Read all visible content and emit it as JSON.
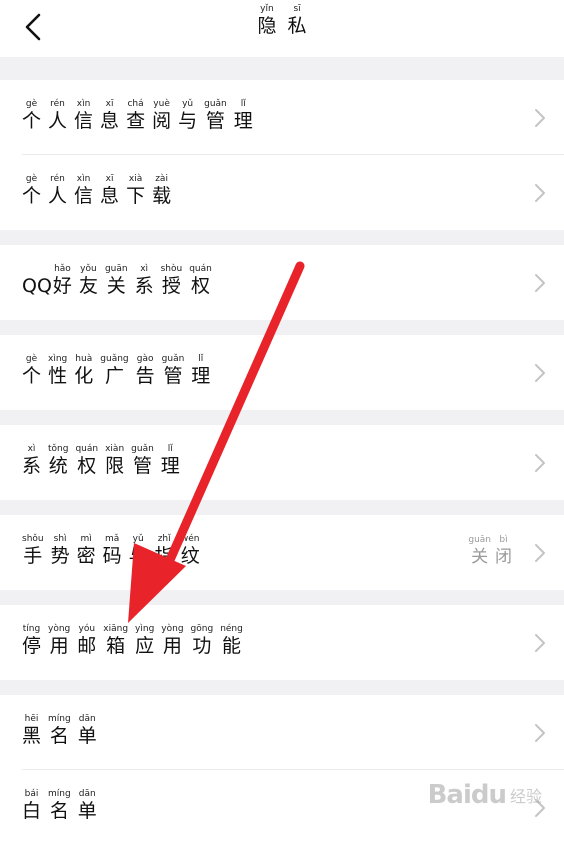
{
  "header": {
    "title": [
      {
        "py": "yǐn",
        "hz": "隐"
      },
      {
        "py": "sī",
        "hz": "私"
      }
    ]
  },
  "groups": [
    {
      "items": [
        {
          "chars": [
            {
              "py": "gè",
              "hz": "个"
            },
            {
              "py": "rén",
              "hz": "人"
            },
            {
              "py": "xìn",
              "hz": "信"
            },
            {
              "py": "xī",
              "hz": "息"
            },
            {
              "py": "chá",
              "hz": "查"
            },
            {
              "py": "yuè",
              "hz": "阅"
            },
            {
              "py": "yǔ",
              "hz": "与"
            },
            {
              "py": "guǎn",
              "hz": "管"
            },
            {
              "py": "lǐ",
              "hz": "理"
            }
          ]
        },
        {
          "chars": [
            {
              "py": "gè",
              "hz": "个"
            },
            {
              "py": "rén",
              "hz": "人"
            },
            {
              "py": "xìn",
              "hz": "信"
            },
            {
              "py": "xī",
              "hz": "息"
            },
            {
              "py": "xià",
              "hz": "下"
            },
            {
              "py": "zài",
              "hz": "载"
            }
          ]
        }
      ]
    },
    {
      "items": [
        {
          "prefix": "QQ",
          "chars": [
            {
              "py": "hǎo",
              "hz": "好"
            },
            {
              "py": "yǒu",
              "hz": "友"
            },
            {
              "py": "guān",
              "hz": "关"
            },
            {
              "py": "xì",
              "hz": "系"
            },
            {
              "py": "shòu",
              "hz": "授"
            },
            {
              "py": "quán",
              "hz": "权"
            }
          ]
        }
      ]
    },
    {
      "items": [
        {
          "chars": [
            {
              "py": "gè",
              "hz": "个"
            },
            {
              "py": "xìng",
              "hz": "性"
            },
            {
              "py": "huà",
              "hz": "化"
            },
            {
              "py": "guǎng",
              "hz": "广"
            },
            {
              "py": "gào",
              "hz": "告"
            },
            {
              "py": "guǎn",
              "hz": "管"
            },
            {
              "py": "lǐ",
              "hz": "理"
            }
          ]
        }
      ]
    },
    {
      "items": [
        {
          "chars": [
            {
              "py": "xì",
              "hz": "系"
            },
            {
              "py": "tǒng",
              "hz": "统"
            },
            {
              "py": "quán",
              "hz": "权"
            },
            {
              "py": "xiàn",
              "hz": "限"
            },
            {
              "py": "guǎn",
              "hz": "管"
            },
            {
              "py": "lǐ",
              "hz": "理"
            }
          ]
        }
      ]
    },
    {
      "items": [
        {
          "chars": [
            {
              "py": "shǒu",
              "hz": "手"
            },
            {
              "py": "shì",
              "hz": "势"
            },
            {
              "py": "mì",
              "hz": "密"
            },
            {
              "py": "mǎ",
              "hz": "码"
            },
            {
              "py": "yǔ",
              "hz": "与"
            },
            {
              "py": "zhǐ",
              "hz": "指"
            },
            {
              "py": "wén",
              "hz": "纹"
            }
          ],
          "status": [
            {
              "py": "guān",
              "hz": "关"
            },
            {
              "py": "bì",
              "hz": "闭"
            }
          ]
        }
      ]
    },
    {
      "items": [
        {
          "chars": [
            {
              "py": "tíng",
              "hz": "停"
            },
            {
              "py": "yòng",
              "hz": "用"
            },
            {
              "py": "yóu",
              "hz": "邮"
            },
            {
              "py": "xiāng",
              "hz": "箱"
            },
            {
              "py": "yìng",
              "hz": "应"
            },
            {
              "py": "yòng",
              "hz": "用"
            },
            {
              "py": "gōng",
              "hz": "功"
            },
            {
              "py": "néng",
              "hz": "能"
            }
          ]
        }
      ]
    },
    {
      "items": [
        {
          "chars": [
            {
              "py": "hēi",
              "hz": "黑"
            },
            {
              "py": "míng",
              "hz": "名"
            },
            {
              "py": "dān",
              "hz": "单"
            }
          ]
        },
        {
          "chars": [
            {
              "py": "bái",
              "hz": "白"
            },
            {
              "py": "míng",
              "hz": "名"
            },
            {
              "py": "dān",
              "hz": "单"
            }
          ]
        }
      ]
    }
  ],
  "watermark": {
    "logo": "Baidu",
    "sub": "经验"
  },
  "colors": {
    "background": "#f1f1f3",
    "row": "#ffffff",
    "chevron": "#c4c4c4",
    "annotation_arrow": "#e8232a"
  },
  "icons": {
    "back": "chevron-left-icon",
    "row": "chevron-right-icon"
  }
}
